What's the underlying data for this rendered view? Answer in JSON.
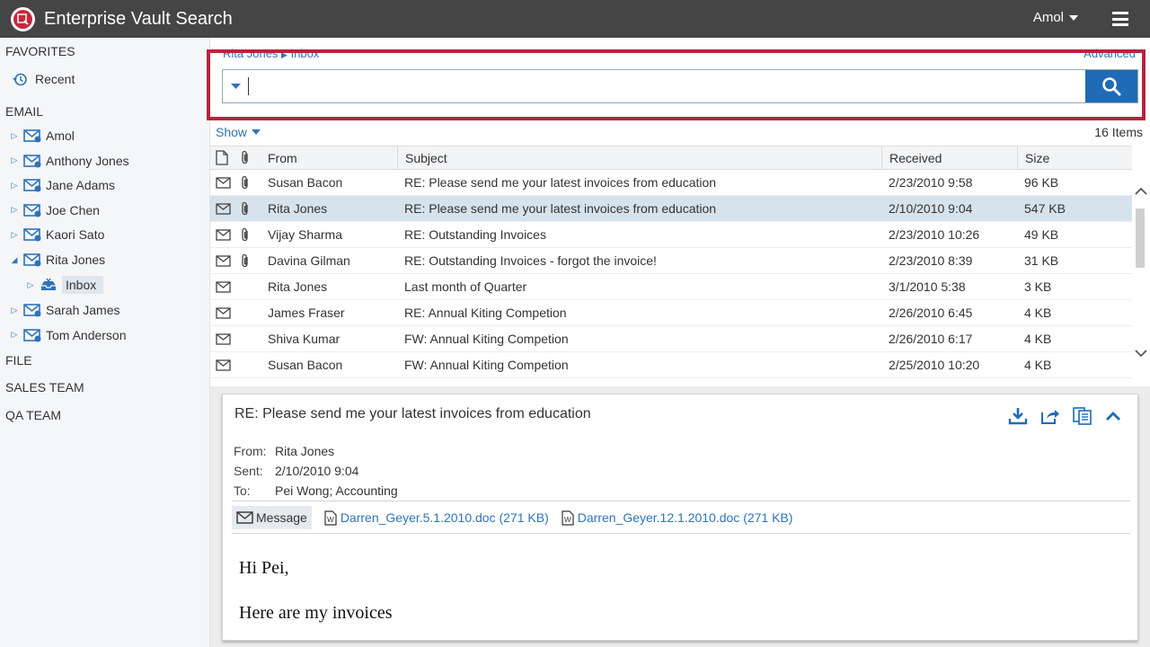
{
  "app": {
    "title": "Enterprise Vault Search",
    "user": "Amol"
  },
  "sidebar": {
    "favorites": "FAVORITES",
    "recent": "Recent",
    "email": "EMAIL",
    "mailboxes": [
      "Amol",
      "Anthony Jones",
      "Jane Adams",
      "Joe Chen",
      "Kaori Sato",
      "Rita Jones"
    ],
    "inbox": "Inbox",
    "mailboxes_after": [
      "Sarah James",
      "Tom Anderson"
    ],
    "file": "FILE",
    "sales_team": "SALES TEAM",
    "qa_team": "QA TEAM"
  },
  "breadcrumb": {
    "owner": "Rita Jones",
    "folder": "Inbox"
  },
  "advanced": "Advanced",
  "search": {
    "value": ""
  },
  "show": "Show",
  "item_count": "16 Items",
  "table": {
    "headers": {
      "from": "From",
      "subject": "Subject",
      "received": "Received",
      "size": "Size"
    },
    "rows": [
      {
        "from": "Susan Bacon",
        "subject": "RE: Please send me your latest invoices from education",
        "received": "2/23/2010 9:58",
        "size": "96 KB",
        "attach": true
      },
      {
        "from": "Rita Jones",
        "subject": "RE: Please send me your latest invoices from education",
        "received": "2/10/2010 9:04",
        "size": "547 KB",
        "attach": true
      },
      {
        "from": "Vijay Sharma",
        "subject": "RE: Outstanding Invoices",
        "received": "2/23/2010 10:26",
        "size": "49 KB",
        "attach": true
      },
      {
        "from": "Davina Gilman",
        "subject": "RE: Outstanding Invoices - forgot the invoice!",
        "received": "2/23/2010 8:39",
        "size": "31 KB",
        "attach": true
      },
      {
        "from": "Rita Jones",
        "subject": "Last month of Quarter",
        "received": "3/1/2010 5:38",
        "size": "3 KB",
        "attach": false
      },
      {
        "from": "James Fraser",
        "subject": "RE: Annual Kiting Competion",
        "received": "2/26/2010 6:45",
        "size": "4 KB",
        "attach": false
      },
      {
        "from": "Shiva Kumar",
        "subject": "FW: Annual Kiting Competion",
        "received": "2/26/2010 6:17",
        "size": "4 KB",
        "attach": false
      },
      {
        "from": "Susan Bacon",
        "subject": "FW: Annual Kiting Competion",
        "received": "2/25/2010 10:20",
        "size": "4 KB",
        "attach": false
      }
    ]
  },
  "preview": {
    "subject": "RE: Please send me your latest invoices from education",
    "from_label": "From:",
    "from": "Rita Jones",
    "sent_label": "Sent:",
    "sent": "2/10/2010 9:04",
    "to_label": "To:",
    "to": "Pei Wong; Accounting",
    "tab_message": "Message",
    "attachments": [
      "Darren_Geyer.5.1.2010.doc (271 KB)",
      "Darren_Geyer.12.1.2010.doc (271 KB)"
    ],
    "body_greeting": "Hi Pei,",
    "body_text": "Here are my invoices"
  },
  "colors": {
    "accent": "#1f6bb5",
    "highlight": "#b3263d",
    "header": "#454545",
    "selected_row": "#d6e3ed"
  }
}
